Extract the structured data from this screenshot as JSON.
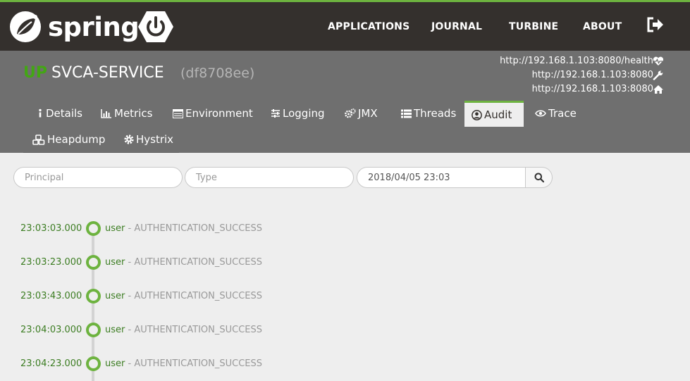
{
  "brand": {
    "name": "spring",
    "color": "#6db33f"
  },
  "nav": {
    "applications": "APPLICATIONS",
    "journal": "JOURNAL",
    "turbine": "TURBINE",
    "about": "ABOUT",
    "logout_icon": "sign-out-icon"
  },
  "instance": {
    "status": "UP",
    "name": "SVCA-SERVICE",
    "id": "(df8708ee)",
    "urls": [
      {
        "text": "http://192.168.1.103:8080/health",
        "icon": "heartbeat-icon"
      },
      {
        "text": "http://192.168.1.103:8080",
        "icon": "wrench-icon"
      },
      {
        "text": "http://192.168.1.103:8080",
        "icon": "home-icon"
      }
    ]
  },
  "tabs": [
    {
      "label": "Details",
      "icon": "info-icon"
    },
    {
      "label": "Metrics",
      "icon": "bar-chart-icon"
    },
    {
      "label": "Environment",
      "icon": "list-icon"
    },
    {
      "label": "Logging",
      "icon": "sliders-icon"
    },
    {
      "label": "JMX",
      "icon": "cogs-icon"
    },
    {
      "label": "Threads",
      "icon": "list-icon"
    },
    {
      "label": "Audit",
      "icon": "user-circle-icon",
      "active": true
    },
    {
      "label": "Trace",
      "icon": "eye-icon"
    },
    {
      "label": "Heapdump",
      "icon": "cubes-icon"
    },
    {
      "label": "Hystrix",
      "icon": "gear-icon"
    }
  ],
  "filters": {
    "principal_placeholder": "Principal",
    "type_placeholder": "Type",
    "date_value": "2018/04/05 23:03"
  },
  "events": [
    {
      "time": "23:03:03.000",
      "principal": "user",
      "type": "- AUTHENTICATION_SUCCESS"
    },
    {
      "time": "23:03:23.000",
      "principal": "user",
      "type": "- AUTHENTICATION_SUCCESS"
    },
    {
      "time": "23:03:43.000",
      "principal": "user",
      "type": "- AUTHENTICATION_SUCCESS"
    },
    {
      "time": "23:04:03.000",
      "principal": "user",
      "type": "- AUTHENTICATION_SUCCESS"
    },
    {
      "time": "23:04:23.000",
      "principal": "user",
      "type": "- AUTHENTICATION_SUCCESS"
    }
  ]
}
